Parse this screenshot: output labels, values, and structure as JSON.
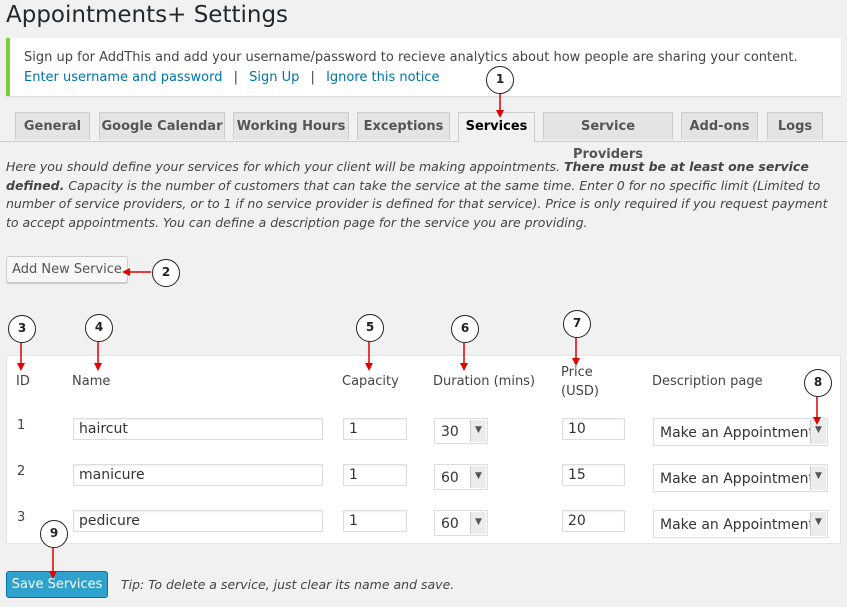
{
  "page": {
    "title": "Appointments+ Settings"
  },
  "notice": {
    "message": "Sign up for AddThis and add your username/password to recieve analytics about how people are sharing your content.",
    "links": [
      "Enter username and password",
      "Sign Up",
      "Ignore this notice"
    ],
    "separator": "|"
  },
  "tabs": [
    {
      "label": "General"
    },
    {
      "label": "Google Calendar"
    },
    {
      "label": "Working Hours"
    },
    {
      "label": "Exceptions"
    },
    {
      "label": "Services",
      "active": true
    },
    {
      "label": "Service Providers"
    },
    {
      "label": "Add-ons"
    },
    {
      "label": "Logs"
    }
  ],
  "description": {
    "part1": "Here you should define your services for which your client will be making appointments. ",
    "bold": "There must be at least one service defined.",
    "part2": " Capacity is the number of customers that can take the service at the same time. Enter 0 for no specific limit (Limited to number of service providers, or to 1 if no service provider is defined for that service). Price is only required if you request payment to accept appointments. You can define a description page for the service you are providing."
  },
  "add_button": "Add New Service",
  "table": {
    "headers": {
      "id": "ID",
      "name": "Name",
      "capacity": "Capacity",
      "duration": "Duration (mins)",
      "price_line1": "Price",
      "price_line2": "(USD)",
      "description_page": "Description page"
    },
    "rows": [
      {
        "id": "1",
        "name": "haircut",
        "capacity": "1",
        "duration": "30",
        "price": "10",
        "page": "Make an Appointment"
      },
      {
        "id": "2",
        "name": "manicure",
        "capacity": "1",
        "duration": "60",
        "price": "15",
        "page": "Make an Appointment"
      },
      {
        "id": "3",
        "name": "pedicure",
        "capacity": "1",
        "duration": "60",
        "price": "20",
        "page": "Make an Appointment"
      }
    ]
  },
  "save_button": "Save Services",
  "tip": "Tip: To delete a service, just clear its name and save.",
  "markers": [
    "1",
    "2",
    "3",
    "4",
    "5",
    "6",
    "7",
    "8",
    "9"
  ],
  "colors": {
    "accent": "#2ea2cc",
    "link": "#0073aa",
    "notice_border": "#7ad03a",
    "arrow": "#e00000"
  }
}
